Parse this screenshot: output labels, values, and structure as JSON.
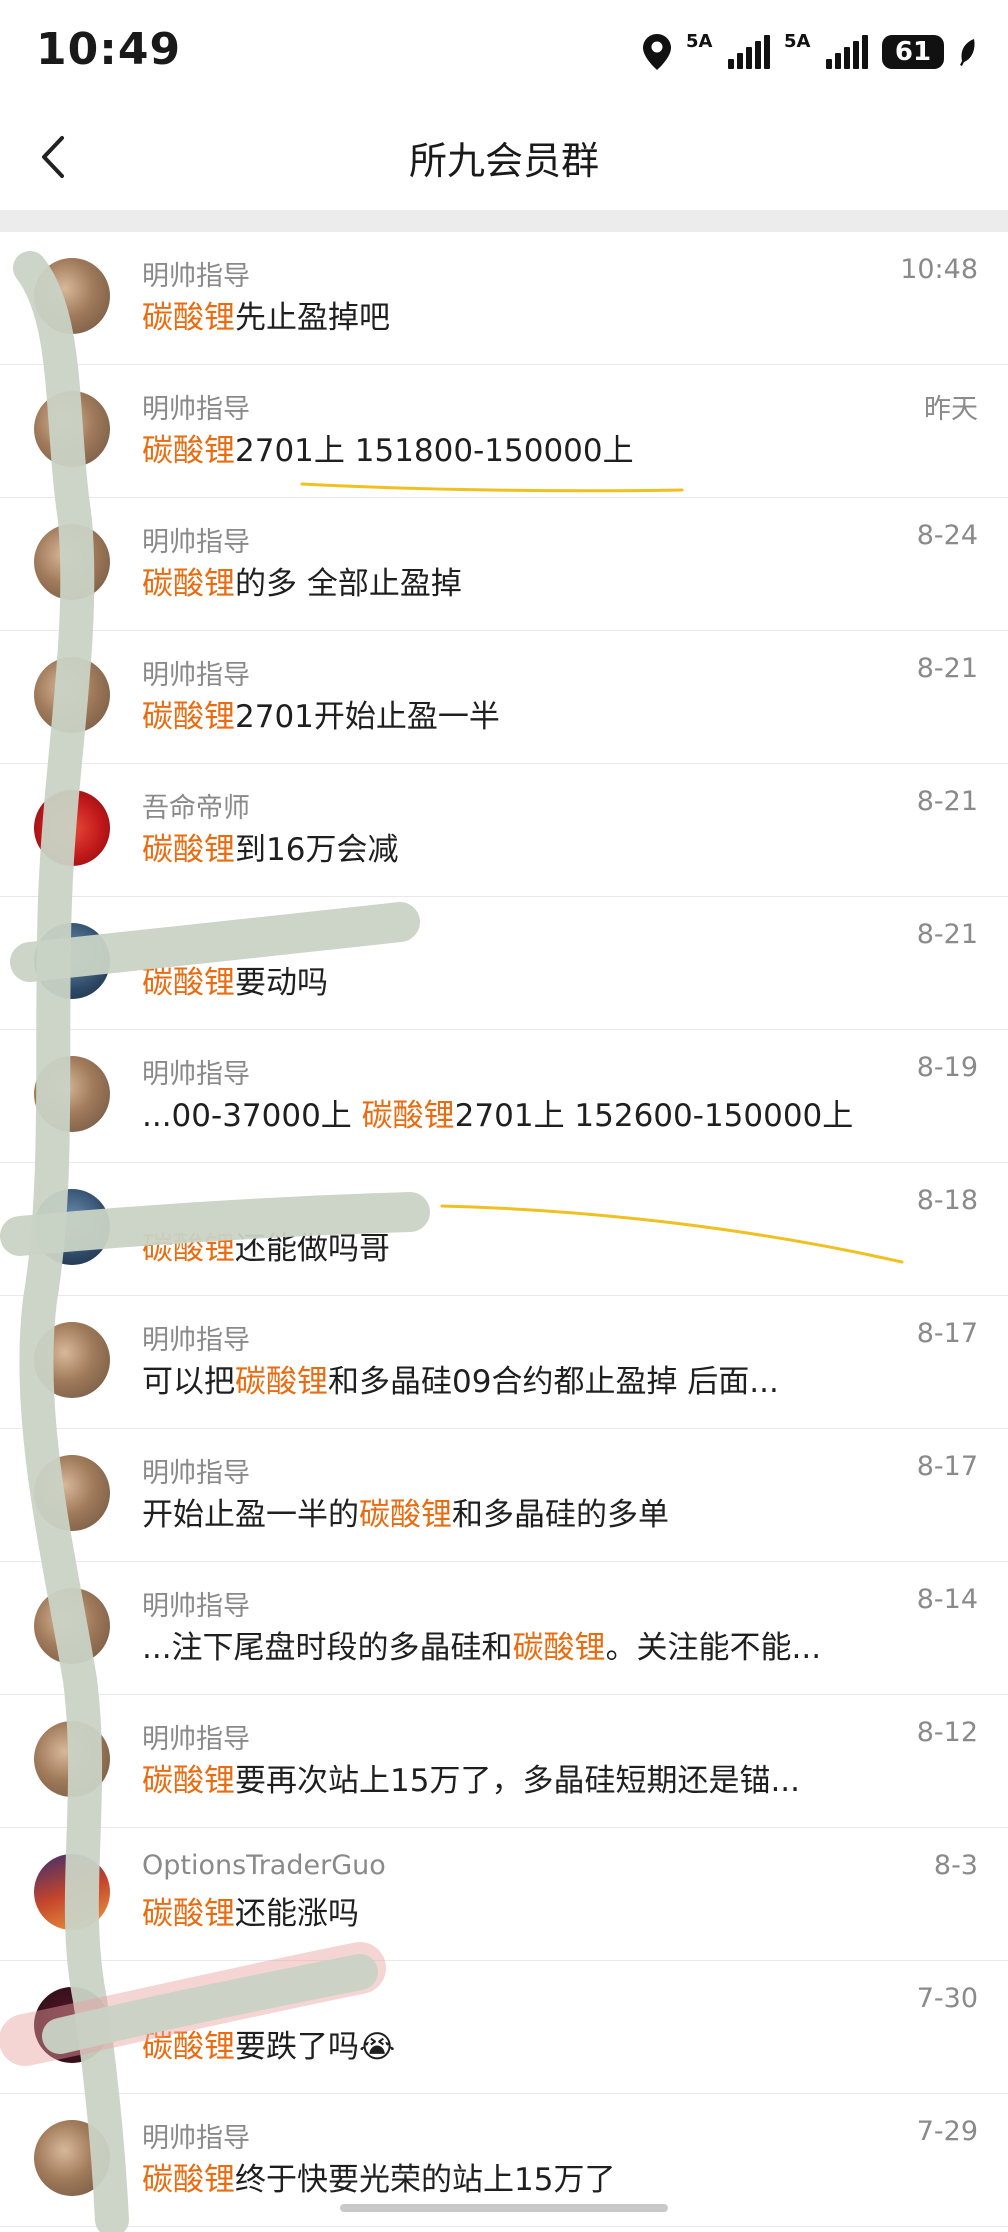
{
  "status_bar": {
    "time": "10:49",
    "signal1_label": "5A",
    "signal2_label": "5A",
    "battery": "61",
    "icons": [
      "location-icon",
      "signal-icon",
      "signal-icon",
      "battery-icon",
      "leaf-icon"
    ]
  },
  "header": {
    "title": "所九会员群",
    "back_icon": "chevron-left-icon"
  },
  "colors": {
    "highlight": "#ea6c10",
    "text": "#1f1f1f",
    "meta": "#8a8a8a",
    "annotation_line": "#f0c020"
  },
  "messages": [
    {
      "sender": "明帅指导",
      "date": "10:48",
      "pre": "",
      "kw": "碳酸锂",
      "post": "先止盈掉吧"
    },
    {
      "sender": "明帅指导",
      "date": "昨天",
      "pre": "",
      "kw": "碳酸锂",
      "post": "2701上  151800-150000上"
    },
    {
      "sender": "明帅指导",
      "date": "8-24",
      "pre": "",
      "kw": "碳酸锂",
      "post": "的多  全部止盈掉"
    },
    {
      "sender": "明帅指导",
      "date": "8-21",
      "pre": "",
      "kw": "碳酸锂",
      "post": "2701开始止盈一半"
    },
    {
      "sender": "吾命帝师",
      "date": "8-21",
      "pre": "",
      "kw": "碳酸锂",
      "post": "到16万会减"
    },
    {
      "sender": "",
      "date": "8-21",
      "pre": "",
      "kw": "碳酸锂",
      "post": "要动吗"
    },
    {
      "sender": "明帅指导",
      "date": "8-19",
      "pre": "...00-37000上  ",
      "kw": "碳酸锂",
      "post": "2701上  152600-150000上"
    },
    {
      "sender": "",
      "date": "8-18",
      "pre": "",
      "kw": "碳酸锂",
      "post": "还能做吗哥"
    },
    {
      "sender": "明帅指导",
      "date": "8-17",
      "pre": "可以把",
      "kw": "碳酸锂",
      "post": "和多晶硅09合约都止盈掉   后面..."
    },
    {
      "sender": "明帅指导",
      "date": "8-17",
      "pre": "开始止盈一半的",
      "kw": "碳酸锂",
      "post": "和多晶硅的多单"
    },
    {
      "sender": "明帅指导",
      "date": "8-14",
      "pre": "...注下尾盘时段的多晶硅和",
      "kw": "碳酸锂",
      "post": "。关注能不能..."
    },
    {
      "sender": "明帅指导",
      "date": "8-12",
      "pre": "",
      "kw": "碳酸锂",
      "post": "要再次站上15万了，多晶硅短期还是锚..."
    },
    {
      "sender": "OptionsTraderGuo",
      "date": "8-3",
      "pre": "",
      "kw": "碳酸锂",
      "post": "还能涨吗"
    },
    {
      "sender": "",
      "date": "7-30",
      "pre": "",
      "kw": "碳酸锂",
      "post": "要跌了吗😭"
    },
    {
      "sender": "明帅指导",
      "date": "7-29",
      "pre": "",
      "kw": "碳酸锂",
      "post": "终于快要光荣的站上15万了"
    }
  ]
}
